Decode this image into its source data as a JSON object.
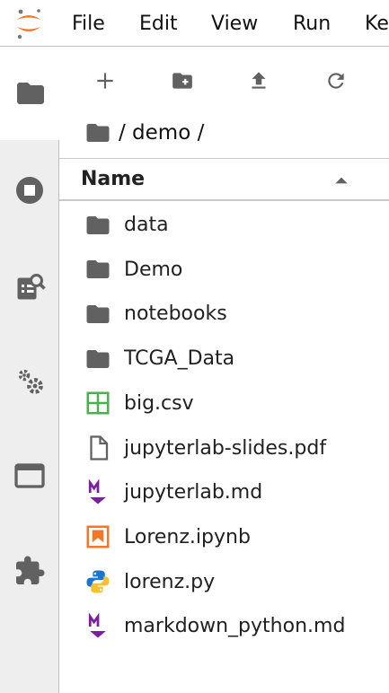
{
  "menubar": {
    "items": [
      "File",
      "Edit",
      "View",
      "Run",
      "Ke"
    ]
  },
  "toolbar": {
    "new_launcher_icon": "plus-icon",
    "new_folder_icon": "new-folder-icon",
    "upload_icon": "upload-icon",
    "refresh_icon": "refresh-icon"
  },
  "breadcrumb": {
    "path": "/ demo /"
  },
  "file_list": {
    "header_name": "Name",
    "sort": "ascending",
    "files": [
      {
        "name": "data",
        "icon": "folder-icon"
      },
      {
        "name": "Demo",
        "icon": "folder-icon"
      },
      {
        "name": "notebooks",
        "icon": "folder-icon"
      },
      {
        "name": "TCGA_Data",
        "icon": "folder-icon"
      },
      {
        "name": "big.csv",
        "icon": "spreadsheet-icon"
      },
      {
        "name": "jupyterlab-slides.pdf",
        "icon": "file-icon"
      },
      {
        "name": "jupyterlab.md",
        "icon": "markdown-icon"
      },
      {
        "name": "Lorenz.ipynb",
        "icon": "notebook-icon"
      },
      {
        "name": "lorenz.py",
        "icon": "python-icon"
      },
      {
        "name": "markdown_python.md",
        "icon": "markdown-icon"
      }
    ]
  },
  "colors": {
    "jupyter_orange": "#f37726",
    "icon_gray": "#616161",
    "csv_green": "#4caf50",
    "markdown_purple": "#7b1fa2",
    "python_blue": "#1976d2",
    "python_yellow": "#fbc02d",
    "sidebar_bg": "#eeeeee"
  }
}
